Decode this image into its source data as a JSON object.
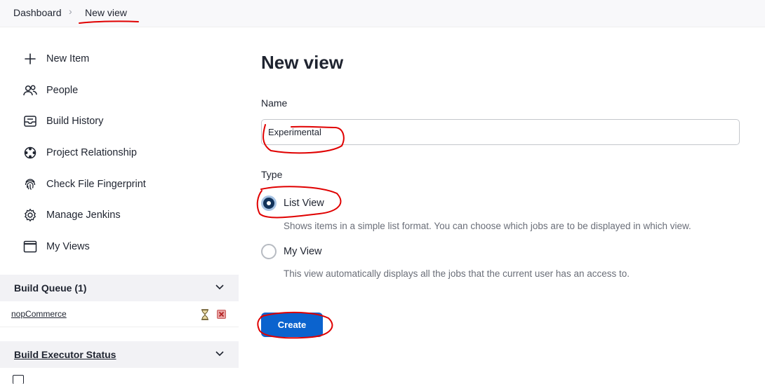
{
  "breadcrumb": {
    "dashboard": "Dashboard",
    "separator": "›",
    "current": "New view"
  },
  "sidebar": {
    "items": [
      {
        "label": "New Item",
        "icon": "plus-icon"
      },
      {
        "label": "People",
        "icon": "people-icon"
      },
      {
        "label": "Build History",
        "icon": "inbox-icon"
      },
      {
        "label": "Project Relationship",
        "icon": "relationship-icon"
      },
      {
        "label": "Check File Fingerprint",
        "icon": "fingerprint-icon"
      },
      {
        "label": "Manage Jenkins",
        "icon": "gear-icon"
      },
      {
        "label": "My Views",
        "icon": "window-icon"
      }
    ]
  },
  "build_queue": {
    "title": "Build Queue (1)",
    "items": [
      {
        "name": "nopCommerce"
      }
    ]
  },
  "executor": {
    "title": "Build Executor Status"
  },
  "main": {
    "title": "New view",
    "name_label": "Name",
    "name_value": "Experimental",
    "type_label": "Type",
    "options": [
      {
        "label": "List View",
        "description": "Shows items in a simple list format. You can choose which jobs are to be displayed in which view.",
        "selected": true
      },
      {
        "label": "My View",
        "description": "This view automatically displays all the jobs that the current user has an access to.",
        "selected": false
      }
    ],
    "create_label": "Create"
  },
  "colors": {
    "accent": "#0b63ce",
    "radio_selected": "#11325a",
    "annotation": "#e00000"
  }
}
